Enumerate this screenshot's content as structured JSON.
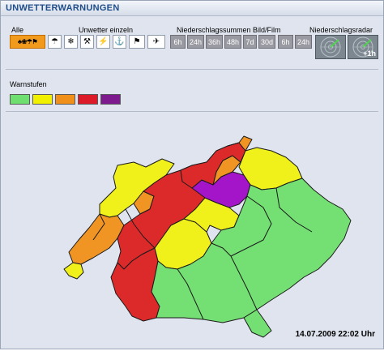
{
  "title": "UNWETTERWARNUNGEN",
  "labels": {
    "all": "Alle",
    "single": "Unwetter einzeln",
    "rain": "Niederschlagssummen Bild/Film",
    "radar": "Niederschlagsradar",
    "levels": "Warnstufen"
  },
  "buttons": {
    "all": "♣❀☂⚑",
    "single_icons": [
      "☂",
      "❄",
      "⚒",
      "⚡",
      "⚓",
      "⚑",
      "✈"
    ],
    "rain_sums": [
      "6h",
      "24h",
      "36h",
      "48h",
      "7d",
      "30d"
    ],
    "rain_film": [
      "6h",
      "24h"
    ],
    "radar_next": "+1h"
  },
  "warnstufen_colors": [
    "#6fe06f",
    "#f0f000",
    "#f0901a",
    "#dc1a28",
    "#7e1a8e"
  ],
  "map_colors": {
    "green": "#74e074",
    "yellow": "#f0f01a",
    "orange": "#f09424",
    "red": "#dc2a2a",
    "purple": "#a414c8",
    "border": "#1a1a1a"
  },
  "timestamp": "14.07.2009 22:02 Uhr"
}
